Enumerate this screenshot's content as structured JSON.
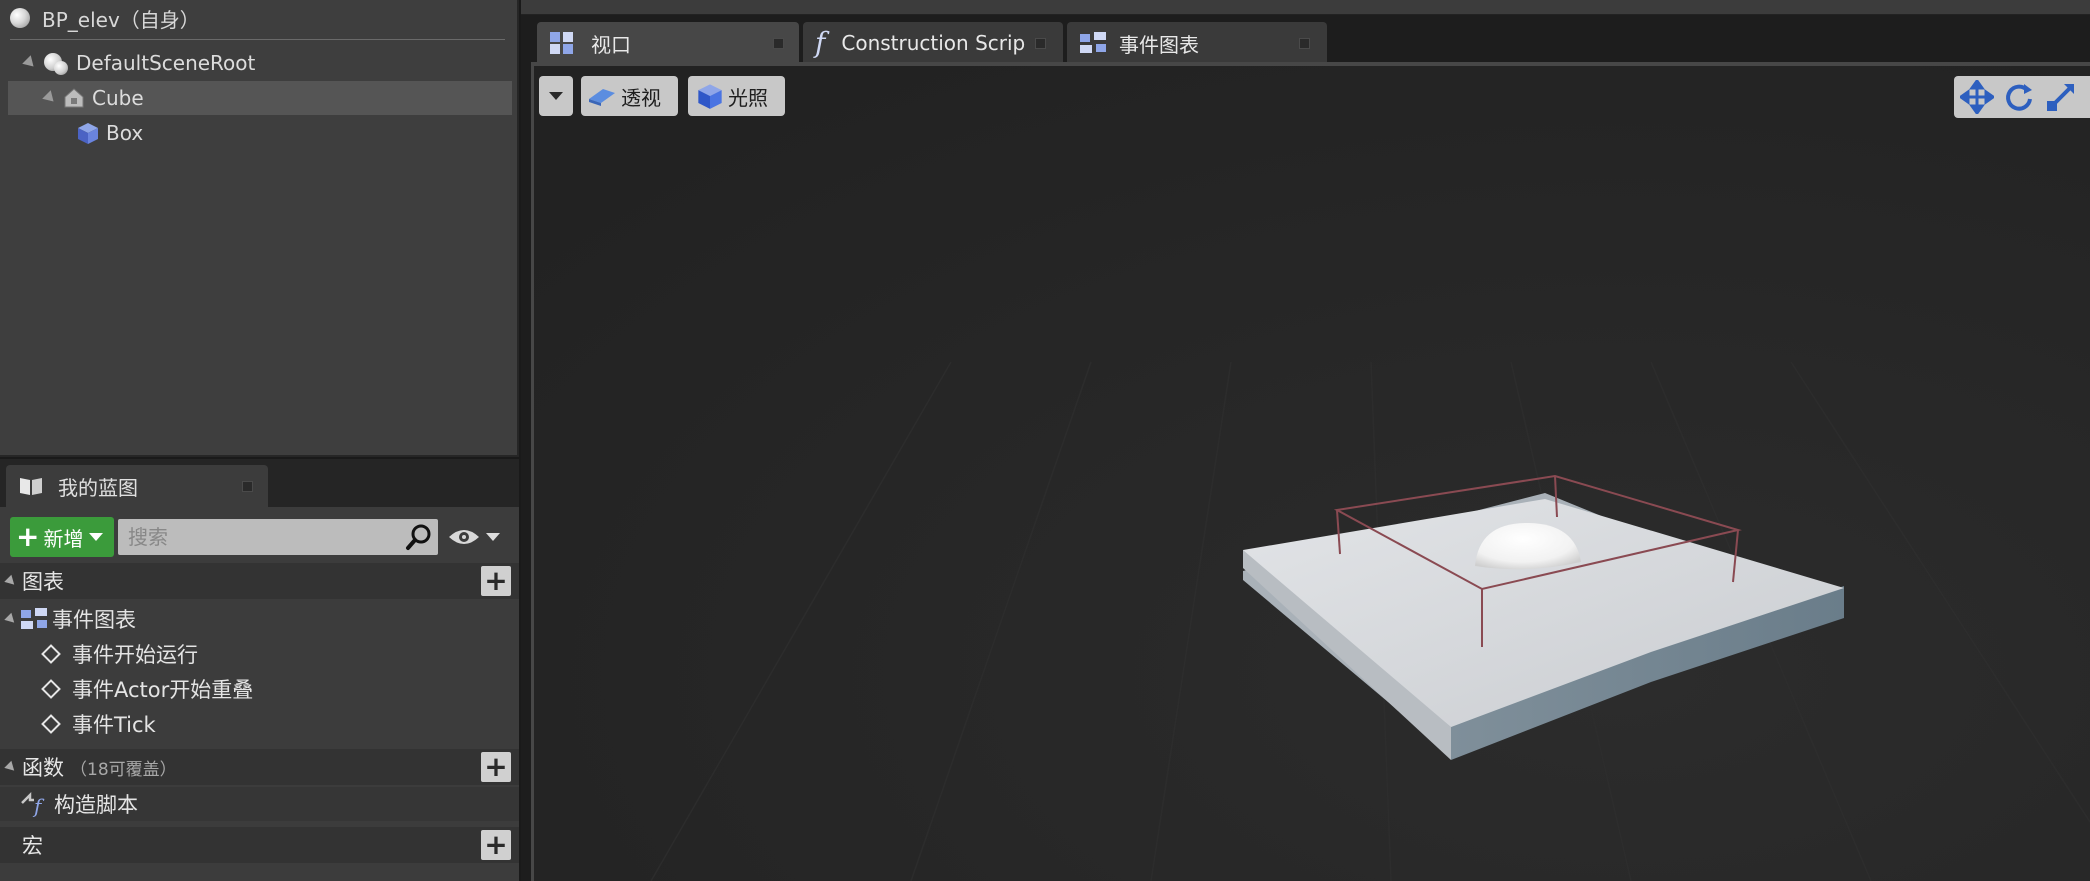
{
  "components": {
    "root_label": "BP_elev（自身）",
    "tree": [
      {
        "label": "DefaultSceneRoot"
      },
      {
        "label": "Cube"
      },
      {
        "label": "Box"
      }
    ]
  },
  "my_blueprint": {
    "tab_label": "我的蓝图",
    "add_button_label": "新增",
    "search_placeholder": "搜索",
    "sections": {
      "graphs": {
        "label": "图表"
      },
      "event_graph": {
        "label": "事件图表"
      },
      "events": [
        {
          "label": "事件开始运行"
        },
        {
          "label": "事件Actor开始重叠"
        },
        {
          "label": "事件Tick"
        }
      ],
      "functions": {
        "label": "函数",
        "note": "（18可覆盖）"
      },
      "construction_script": {
        "label": "构造脚本"
      },
      "macros": {
        "label": "宏"
      }
    }
  },
  "editor": {
    "tabs": [
      {
        "label": "视口",
        "icon": "viewport-icon"
      },
      {
        "label": "Construction Scrip",
        "icon": "function-icon"
      },
      {
        "label": "事件图表",
        "icon": "event-graph-icon"
      }
    ],
    "viewport": {
      "perspective_label": "透视",
      "lighting_label": "光照"
    }
  },
  "colors": {
    "add_button_green": "#3b9b3b",
    "panel_bg": "#3e3e3e",
    "viewport_bg": "#262626",
    "wire_bounds": "#8a4a52"
  }
}
